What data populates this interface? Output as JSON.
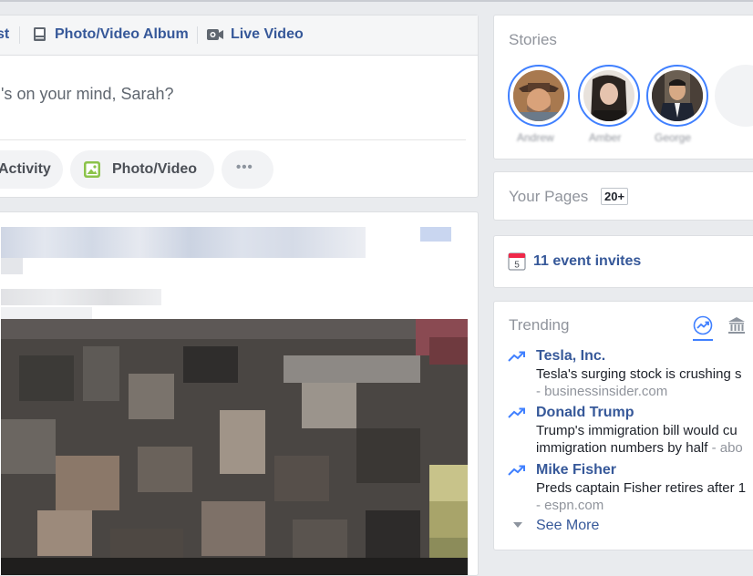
{
  "composer": {
    "tabs": [
      {
        "label": "st",
        "icon": "pencil-icon"
      },
      {
        "label": "Photo/Video Album",
        "icon": "album-icon"
      },
      {
        "label": "Live Video",
        "icon": "video-camera-icon"
      }
    ],
    "prompt": "'s on your mind, Sarah?",
    "actions": [
      {
        "label": "Activity"
      },
      {
        "label": "Photo/Video",
        "icon": "photo-icon"
      },
      {
        "label": "•••"
      }
    ]
  },
  "stories": {
    "heading": "Stories",
    "people": [
      "Andrew",
      "Amber",
      "George"
    ]
  },
  "pages": {
    "heading": "Your Pages",
    "badge": "20+"
  },
  "events": {
    "icon_day": "5",
    "label": "11 event invites"
  },
  "trending": {
    "heading": "Trending",
    "items": [
      {
        "title": "Tesla, Inc.",
        "desc": "Tesla's surging stock is crushing s",
        "source": "- businessinsider.com"
      },
      {
        "title": "Donald Trump",
        "desc": "Trump's immigration bill would cu",
        "desc2": "immigration numbers by half",
        "source_inline": " - abo"
      },
      {
        "title": "Mike Fisher",
        "desc": "Preds captain Fisher retires after 1",
        "source": "- espn.com"
      }
    ],
    "see_more": "See More"
  },
  "colors": {
    "link": "#365899",
    "accent": "#4080ff",
    "background": "#e9ebee"
  }
}
